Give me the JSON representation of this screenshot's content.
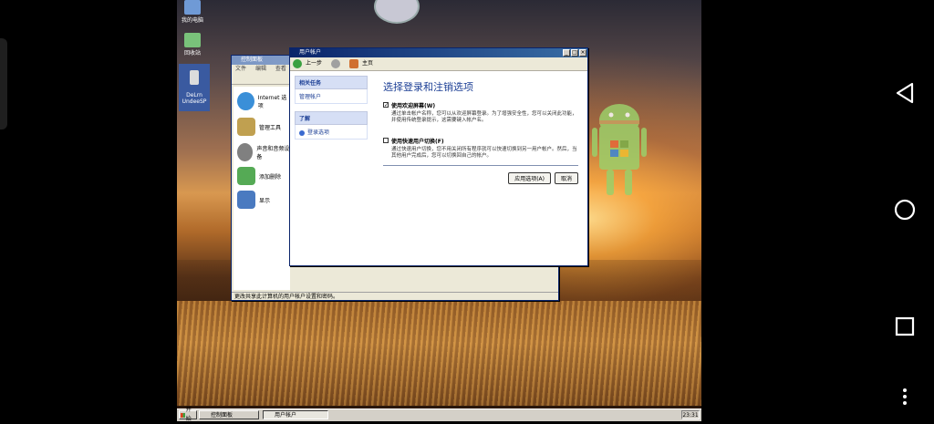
{
  "desktop_icons": [
    {
      "label": "我的电脑",
      "color": "#6f9ad6"
    },
    {
      "label": "回收站",
      "color": "#79c27a"
    },
    {
      "label": "DeLrn\nUndeeSP",
      "color": "#dcdcdc"
    }
  ],
  "control_panel": {
    "title": "控制面板",
    "menu": [
      "文件",
      "编辑",
      "查看"
    ],
    "items": [
      {
        "label": "Internet 选项",
        "color": "#3a8fd8"
      },
      {
        "label": "管理工具",
        "color": "#c0a050"
      },
      {
        "label": "声音和音频设备",
        "color": "#808080"
      },
      {
        "label": "添加删除",
        "color": "#55aa55"
      },
      {
        "label": "显示",
        "color": "#4a7ac0"
      }
    ],
    "status": "更改共享此计算机的用户帐户设置和密码。"
  },
  "user_accounts": {
    "title": "用户帐户",
    "back_label": "上一步",
    "home_label": "主页",
    "sidebar": {
      "related_title": "相关任务",
      "related_link": "管理帐户",
      "learn_title": "了解",
      "learn_link": "登录选项"
    },
    "heading": "选择登录和注销选项",
    "options": [
      {
        "label": "使用欢迎屏幕(W)",
        "checked": true,
        "desc": "通过单击帐户名称，您可以从欢迎屏幕登录。为了增强安全性，您可以关闭此功能，并使用传统登录提示，这需要键入帐户名。"
      },
      {
        "label": "使用快速用户切换(F)",
        "checked": false,
        "desc": "通过快速用户切换，您不用关闭所有程序就可以快速切换到另一用户帐户。然后，当其他用户完成后，您可以切换回自己的帐户。"
      }
    ],
    "apply_button": "应用选项(A)",
    "cancel_button": "取消"
  },
  "taskbar": {
    "start_label": "开始",
    "tasks": [
      "控制面板",
      "用户帐户"
    ],
    "clock": "23:31"
  }
}
